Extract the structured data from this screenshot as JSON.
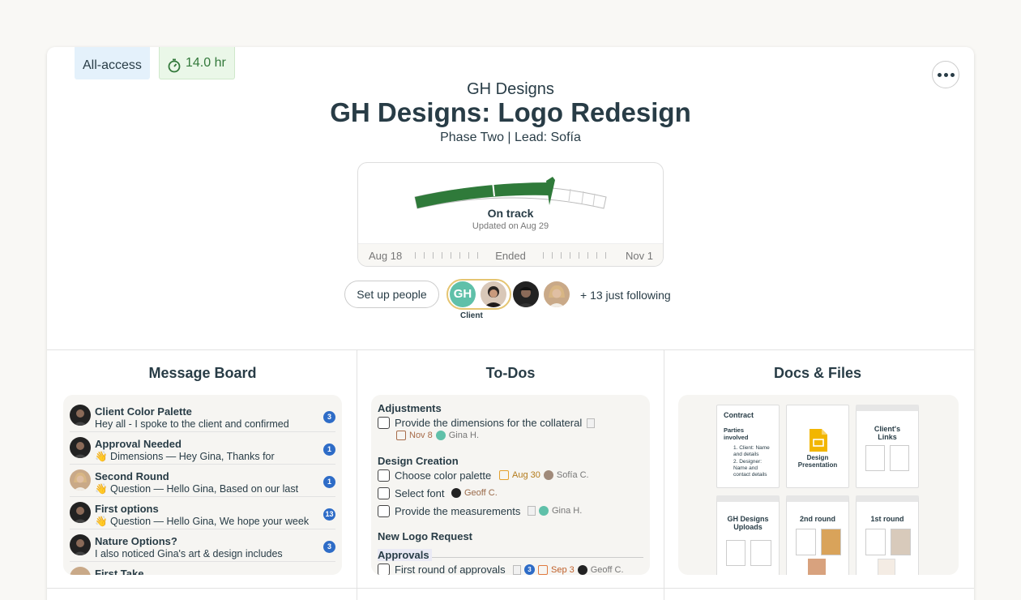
{
  "badges": {
    "access": "All-access",
    "hours": "14.0 hr"
  },
  "project": {
    "company": "GH Designs",
    "title": "GH Designs: Logo Redesign",
    "subtitle": "Phase Two | Lead: Sofía"
  },
  "hill_chart": {
    "status": "On track",
    "updated": "Updated on Aug 29",
    "start": "Aug 18",
    "middle": "Ended",
    "end": "Nov 1",
    "progress_fraction": 0.7,
    "fill_color": "#2f7a3a"
  },
  "people": {
    "setup_label": "Set up people",
    "client_initials": "GH",
    "client_label": "Client",
    "following": "+ 13 just following"
  },
  "sections": {
    "message_board": "Message Board",
    "todos": "To-Dos",
    "docs": "Docs & Files"
  },
  "messages": [
    {
      "title": "Client Color Palette",
      "excerpt": "Hey all - I spoke to the client and confirmed",
      "count": "3"
    },
    {
      "title": "Approval Needed",
      "excerpt": "👋 Dimensions — Hey Gina, Thanks for",
      "count": "1"
    },
    {
      "title": "Second Round",
      "excerpt": "👋 Question — Hello Gina, Based on our last",
      "count": "1"
    },
    {
      "title": "First options",
      "excerpt": "👋 Question — Hello Gina, We hope your week",
      "count": "13"
    },
    {
      "title": "Nature Options?",
      "excerpt": "I also noticed Gina's art & design includes",
      "count": "3"
    },
    {
      "title": "First Take",
      "excerpt": "",
      "count": ""
    }
  ],
  "todos": {
    "groups": [
      {
        "name": "Adjustments",
        "items": [
          {
            "text": "Provide the dimensions for the collateral",
            "date": "Nov 8",
            "assignee": "Gina H."
          }
        ]
      },
      {
        "name": "Design Creation",
        "items": [
          {
            "text": "Choose color palette",
            "date": "Aug 30",
            "assignee": "Sofía C."
          },
          {
            "text": "Select font",
            "assignee": "Geoff C."
          },
          {
            "text": "Provide the measurements",
            "assignee": "Gina H."
          }
        ]
      },
      {
        "name": "New Logo Request"
      },
      {
        "name": "Approvals",
        "items": [
          {
            "text": "First round of approvals",
            "count": "3",
            "date": "Sep 3",
            "assignee": "Geoff C."
          }
        ]
      }
    ]
  },
  "docs": [
    {
      "title": "Contract",
      "lines": [
        "Parties involved",
        "1. Client: Name and details",
        "2. Designer: Name and contact details"
      ]
    },
    {
      "title": "Design Presentation"
    },
    {
      "title": "Client's Links"
    },
    {
      "title": "GH Designs Uploads"
    },
    {
      "title": "2nd round"
    },
    {
      "title": "1st round"
    }
  ]
}
